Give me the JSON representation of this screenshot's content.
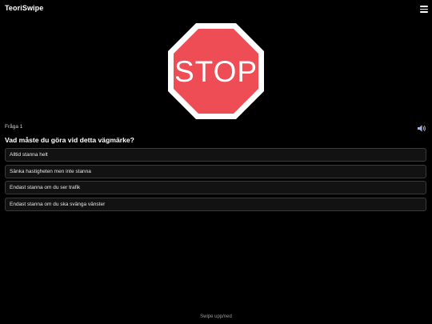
{
  "app": {
    "title": "TeoriSwipe",
    "menu_icon": "hamburger-menu-icon"
  },
  "sign": {
    "text": "STOP",
    "icon": "stop-sign-icon",
    "fill_color": "#ee4d55",
    "border_color": "#ffffff"
  },
  "question": {
    "counter": "Fråga 1",
    "text": "Vad måste du göra vid detta vägmärke?",
    "speaker_icon": "speaker-icon"
  },
  "answers": [
    {
      "label": "Alltid stanna helt"
    },
    {
      "label": "Sänka hastigheten men inte stanna"
    },
    {
      "label": "Endast stanna om du ser trafik"
    },
    {
      "label": "Endast stanna om du ska svänga vänster"
    }
  ],
  "footer": {
    "hint": "Swipe upp/ned"
  },
  "colors": {
    "background": "#000000",
    "answer_background": "#121212",
    "answer_border": "#3a3a3a"
  }
}
